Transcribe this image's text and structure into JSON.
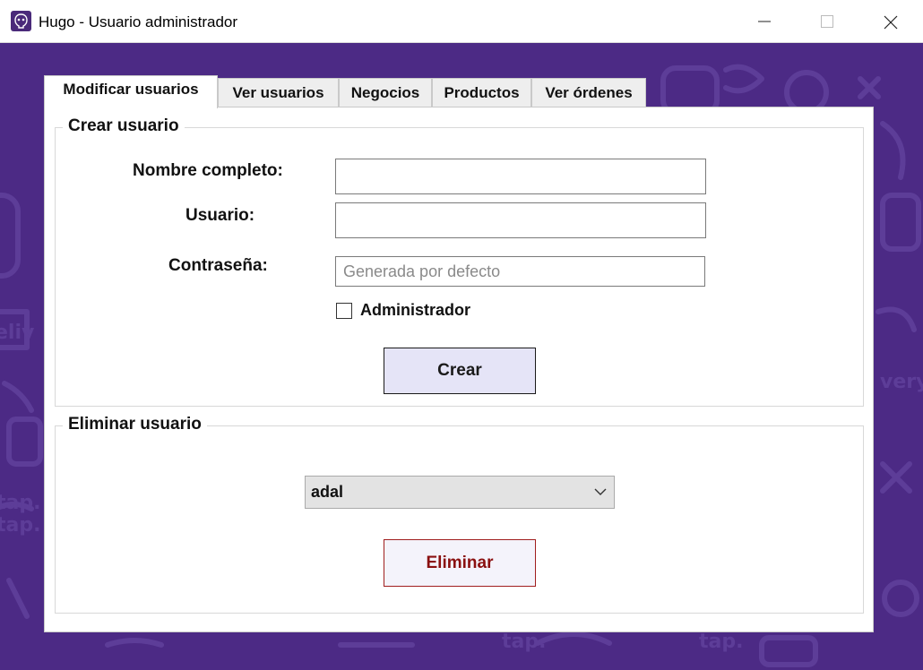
{
  "window": {
    "title": "Hugo - Usuario administrador",
    "controls": [
      "minimize-icon",
      "maximize-icon",
      "close-icon"
    ]
  },
  "tabs": [
    {
      "label": "Modificar usuarios",
      "active": true
    },
    {
      "label": "Ver usuarios",
      "active": false
    },
    {
      "label": "Negocios",
      "active": false
    },
    {
      "label": "Productos",
      "active": false
    },
    {
      "label": "Ver órdenes",
      "active": false
    }
  ],
  "crear": {
    "legend": "Crear usuario",
    "nombre_label": "Nombre completo:",
    "nombre_value": "",
    "usuario_label": "Usuario:",
    "usuario_value": "",
    "contrasena_label": "Contraseña:",
    "contrasena_placeholder": "Generada por defecto",
    "admin_label": "Administrador",
    "admin_checked": false,
    "button": "Crear"
  },
  "eliminar": {
    "legend": "Eliminar usuario",
    "selected_user": "adal",
    "button": "Eliminar"
  },
  "colors": {
    "background": "#4c2a85",
    "create_button": "#e5e4f7",
    "delete_text": "#8a1010"
  }
}
